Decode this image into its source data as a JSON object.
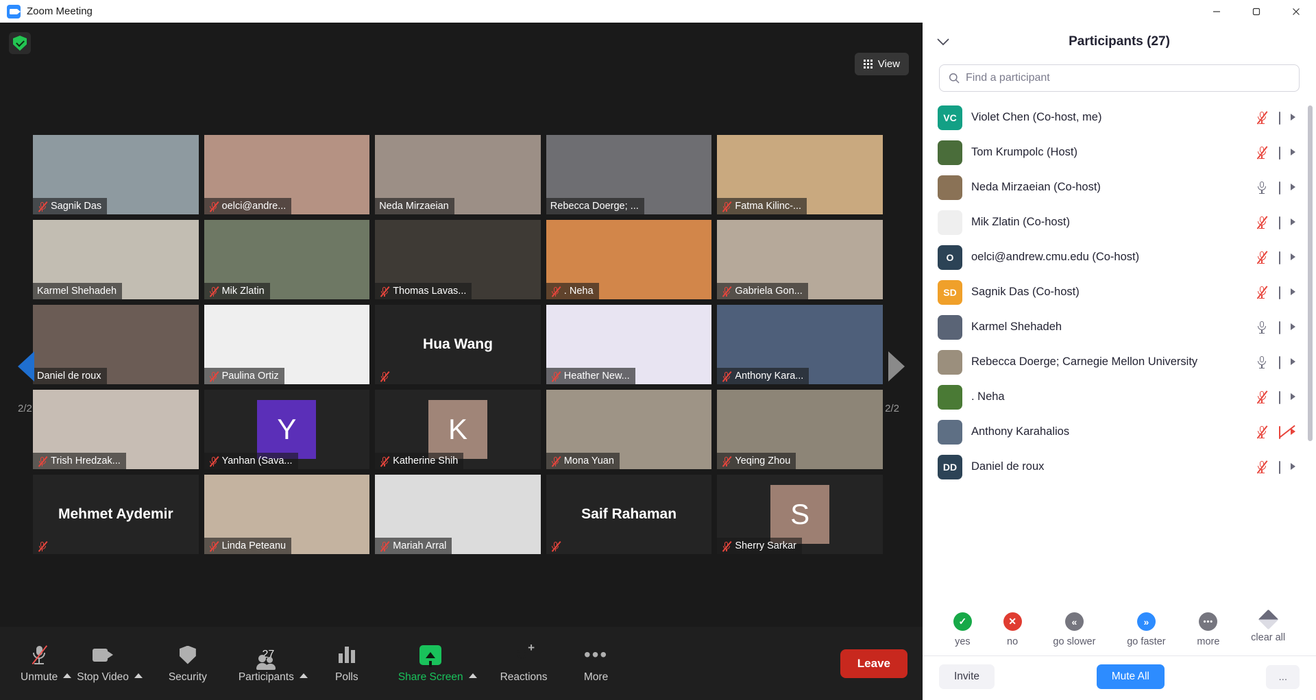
{
  "window": {
    "title": "Zoom Meeting",
    "app_icon": "zoom-camera-icon",
    "minimize": "minimize-icon",
    "maximize": "maximize-icon",
    "close": "close-icon"
  },
  "stage": {
    "security_badge": "shield-check-icon",
    "view_button": {
      "label": "View",
      "icon": "grid-icon"
    },
    "page_indicator_left": "2/2",
    "page_indicator_right": "2/2",
    "prev_arrow": "left-triangle-icon",
    "next_arrow": "right-triangle-icon",
    "tiles": [
      {
        "name": "Sagnik Das",
        "muted": true,
        "style": "photo",
        "bg": "#8e9aa0"
      },
      {
        "name": "oelci@andre...",
        "muted": true,
        "style": "photo",
        "bg": "#b59283"
      },
      {
        "name": "Neda Mirzaeian",
        "muted": false,
        "style": "photo",
        "bg": "#9c8f86"
      },
      {
        "name": "Rebecca Doerge; ...",
        "muted": false,
        "style": "photo",
        "bg": "#6e6e72"
      },
      {
        "name": "Fatma Kilinc-...",
        "muted": true,
        "style": "photo",
        "bg": "#c9a97f"
      },
      {
        "name": "Karmel Shehadeh",
        "muted": false,
        "style": "photo",
        "bg": "#c2bdb2",
        "active": true
      },
      {
        "name": "Mik Zlatin",
        "muted": true,
        "style": "photo",
        "bg": "#6e7864"
      },
      {
        "name": "Thomas Lavas...",
        "muted": true,
        "style": "photo",
        "bg": "#3e3a35"
      },
      {
        "name": ". Neha",
        "muted": true,
        "style": "photo",
        "bg": "#d2864a"
      },
      {
        "name": "Gabriela Gon...",
        "muted": true,
        "style": "photo",
        "bg": "#b6a99a"
      },
      {
        "name": "Daniel de roux",
        "muted": false,
        "style": "photo",
        "bg": "#6b5c55"
      },
      {
        "name": "Paulina Ortiz",
        "muted": true,
        "style": "photo",
        "bg": "#efefef"
      },
      {
        "name": "Hua Wang",
        "muted": true,
        "style": "bigname"
      },
      {
        "name": "Heather New...",
        "muted": true,
        "style": "photo",
        "bg": "#e8e4f2"
      },
      {
        "name": "Anthony Kara...",
        "muted": true,
        "style": "photo",
        "bg": "#4e5f7a"
      },
      {
        "name": "Trish Hredzak...",
        "muted": true,
        "style": "photo",
        "bg": "#c7bdb4"
      },
      {
        "name": "Yanhan (Sava...",
        "muted": true,
        "style": "letter",
        "letter": "Y",
        "bg": "#5b2fb8"
      },
      {
        "name": "Katherine Shih",
        "muted": true,
        "style": "letter",
        "letter": "K",
        "bg": "#a08578"
      },
      {
        "name": "Mona Yuan",
        "muted": true,
        "style": "photo",
        "bg": "#9e9486"
      },
      {
        "name": "Yeqing Zhou",
        "muted": true,
        "style": "photo",
        "bg": "#8d8577"
      },
      {
        "name": "Mehmet Aydemir",
        "muted": true,
        "style": "bigname"
      },
      {
        "name": "Linda Peteanu",
        "muted": true,
        "style": "photo",
        "bg": "#c4b3a0"
      },
      {
        "name": "Mariah Arral",
        "muted": true,
        "style": "photo",
        "bg": "#dcdcdc"
      },
      {
        "name": "Saif Rahaman",
        "muted": true,
        "style": "bigname"
      },
      {
        "name": "Sherry Sarkar",
        "muted": true,
        "style": "letter",
        "letter": "S",
        "bg": "#9d7f72"
      }
    ]
  },
  "toolbar": {
    "items": [
      {
        "label": "Unmute",
        "icon": "mic-muted-icon",
        "caret": true,
        "highlight": false
      },
      {
        "label": "Stop Video",
        "icon": "camera-icon",
        "caret": true,
        "highlight": false
      },
      {
        "label": "Security",
        "icon": "shield-icon",
        "caret": false,
        "highlight": false
      },
      {
        "label": "Participants",
        "icon": "people-icon",
        "caret": true,
        "highlight": false,
        "count": "27"
      },
      {
        "label": "Polls",
        "icon": "poll-bars-icon",
        "caret": false,
        "highlight": false
      },
      {
        "label": "Share Screen",
        "icon": "share-screen-icon",
        "caret": true,
        "highlight": true
      },
      {
        "label": "Reactions",
        "icon": "reaction-smiley-icon",
        "caret": false,
        "highlight": false
      },
      {
        "label": "More",
        "icon": "ellipsis-icon",
        "caret": false,
        "highlight": false
      }
    ],
    "leave_label": "Leave"
  },
  "panel": {
    "collapse_icon": "chevron-down-icon",
    "title": "Participants (27)",
    "search": {
      "placeholder": "Find a participant",
      "value": "",
      "icon": "search-icon"
    },
    "participants": [
      {
        "name": "Violet Chen (Co-host, me)",
        "avatar_type": "initials",
        "initials": "VC",
        "color": "#13a085",
        "mic": "muted",
        "cam": "on"
      },
      {
        "name": "Tom Krumpolc (Host)",
        "avatar_type": "photo",
        "color": "#4a6d3a",
        "mic": "muted",
        "cam": "on"
      },
      {
        "name": "Neda Mirzaeian (Co-host)",
        "avatar_type": "photo",
        "color": "#8a7256",
        "mic": "unmuted",
        "cam": "on"
      },
      {
        "name": "Mik Zlatin (Co-host)",
        "avatar_type": "photo",
        "color": "#efefef",
        "mic": "muted",
        "cam": "on"
      },
      {
        "name": "oelci@andrew.cmu.edu (Co-host)",
        "avatar_type": "initials",
        "initials": "O",
        "color": "#2c4356",
        "mic": "muted",
        "cam": "on"
      },
      {
        "name": "Sagnik Das (Co-host)",
        "avatar_type": "initials",
        "initials": "SD",
        "color": "#f0a02a",
        "mic": "muted",
        "cam": "on"
      },
      {
        "name": "Karmel Shehadeh",
        "avatar_type": "photo",
        "color": "#5a6476",
        "mic": "unmuted",
        "cam": "on"
      },
      {
        "name": "Rebecca Doerge; Carnegie Mellon University",
        "avatar_type": "photo",
        "color": "#9b8f7d",
        "mic": "unmuted",
        "cam": "on"
      },
      {
        "name": ". Neha",
        "avatar_type": "photo",
        "color": "#4a7a35",
        "mic": "muted",
        "cam": "on"
      },
      {
        "name": "Anthony Karahalios",
        "avatar_type": "photo",
        "color": "#5e6f84",
        "mic": "muted",
        "cam": "off"
      },
      {
        "name": "Daniel de roux",
        "avatar_type": "initials",
        "initials": "DD",
        "color": "#2c4356",
        "mic": "muted",
        "cam": "on"
      }
    ],
    "reactions": [
      {
        "label": "yes",
        "icon": "check-icon",
        "glyph": "✓",
        "color": "#17a948",
        "shape": "circle"
      },
      {
        "label": "no",
        "icon": "cross-icon",
        "glyph": "✕",
        "color": "#e03c31",
        "shape": "circle"
      },
      {
        "label": "go slower",
        "icon": "double-left-icon",
        "glyph": "«",
        "color": "#76767f",
        "shape": "circle"
      },
      {
        "label": "go faster",
        "icon": "double-right-icon",
        "glyph": "»",
        "color": "#2D8CFF",
        "shape": "circle"
      },
      {
        "label": "more",
        "icon": "ellipsis-icon",
        "glyph": "•••",
        "color": "#76767f",
        "shape": "circle"
      },
      {
        "label": "clear all",
        "icon": "clear-all-icon",
        "glyph": "",
        "color": "#76767f",
        "shape": "diamond"
      }
    ],
    "footer": {
      "invite_label": "Invite",
      "mute_all_label": "Mute All",
      "more_label": "..."
    }
  }
}
